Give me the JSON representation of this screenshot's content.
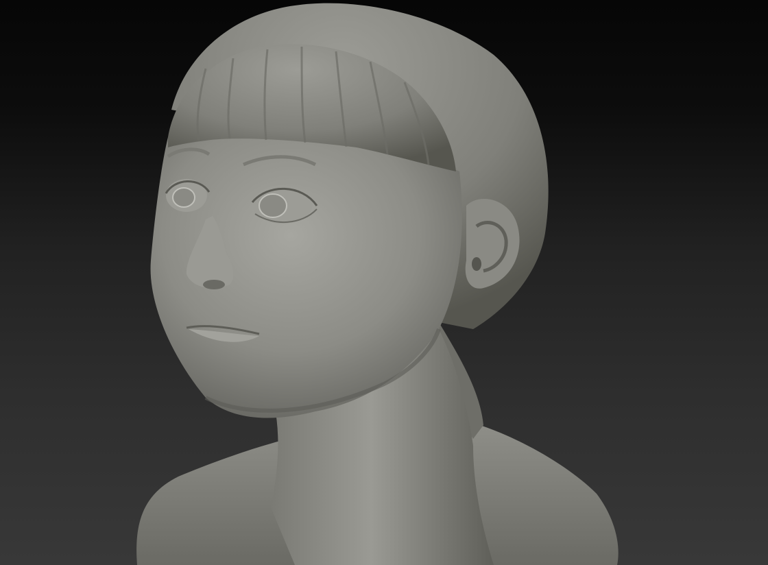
{
  "scene": {
    "background": {
      "top": "#060606",
      "bottom": "#383838"
    },
    "model": {
      "subject": "sculpted-child-bust",
      "material_color": "#8e8e88",
      "highlight_color": "#b4b4ae",
      "shadow_color": "#54544f"
    }
  }
}
